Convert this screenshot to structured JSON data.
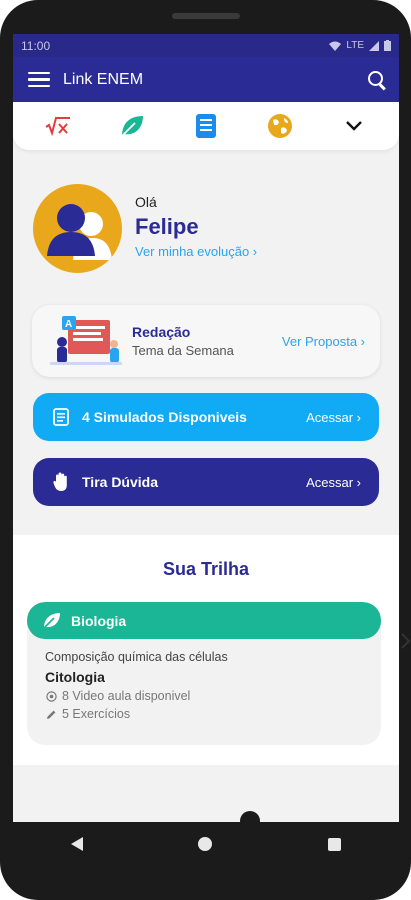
{
  "status": {
    "time": "11:00",
    "network": "LTE"
  },
  "appbar": {
    "title": "Link ENEM"
  },
  "subjects": [
    "matematica-icon",
    "biologia-icon",
    "livro-icon",
    "geografia-icon"
  ],
  "profile": {
    "greeting": "Olá",
    "name": "Felipe",
    "evolution_link": "Ver minha evolução ›"
  },
  "redacao": {
    "title": "Redação",
    "subtitle": "Tema da Semana",
    "link": "Ver Proposta ›"
  },
  "simulados": {
    "label": "4 Simulados Disponiveis",
    "action": "Acessar ›"
  },
  "tira_duvida": {
    "label": "Tira Dúvida",
    "action": "Acessar ›"
  },
  "trilha": {
    "title": "Sua Trilha",
    "card": {
      "subject": "Biologia",
      "topic": "Composição química das células",
      "subtopic": "Citologia",
      "videos": "8 Video aula disponivel",
      "exercises": "5 Exercícios"
    }
  },
  "colors": {
    "primary": "#2b2b95",
    "accent": "#11aaf5",
    "link": "#2aa4f0",
    "biology": "#1ab695",
    "avatar_bg": "#e9a71c"
  }
}
